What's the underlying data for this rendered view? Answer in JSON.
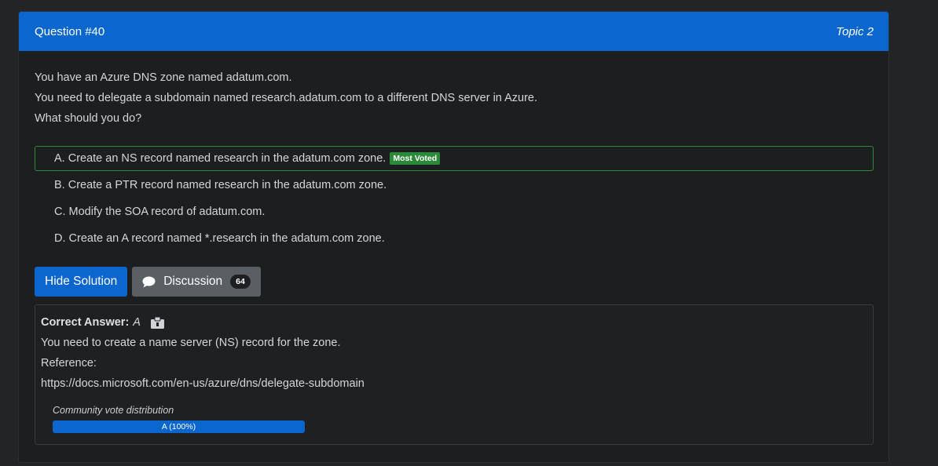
{
  "header": {
    "question": "Question #40",
    "topic": "Topic 2"
  },
  "question": {
    "lines": [
      "You have an Azure DNS zone named adatum.com.",
      "You need to delegate a subdomain named research.adatum.com to a different DNS server in Azure.",
      "What should you do?"
    ]
  },
  "choices": [
    {
      "text": "A. Create an NS record named research in the adatum.com zone.",
      "badge": "Most Voted"
    },
    {
      "text": "B. Create a PTR record named research in the adatum.com zone."
    },
    {
      "text": "C. Modify the SOA record of adatum.com."
    },
    {
      "text": "D. Create an A record named *.research in the adatum.com zone."
    }
  ],
  "actions": {
    "hide_solution": "Hide Solution",
    "discussion": "Discussion",
    "discussion_count": "64"
  },
  "answer": {
    "label": "Correct Answer:",
    "value": "A",
    "explanation": "You need to create a name server (NS) record for the zone.",
    "reference_label": "Reference:",
    "reference_url": "https://docs.microsoft.com/en-us/azure/dns/delegate-subdomain"
  },
  "votes": {
    "title": "Community vote distribution",
    "bar_label": "A (100%)",
    "percent": 100
  },
  "colors": {
    "header": "#0b66cd",
    "voted_border": "#2f8a3c",
    "badge_green": "#2a8a3a"
  },
  "icons": {
    "discussion": "chat-bubble-icon",
    "reveal": "clipboard-icon"
  }
}
